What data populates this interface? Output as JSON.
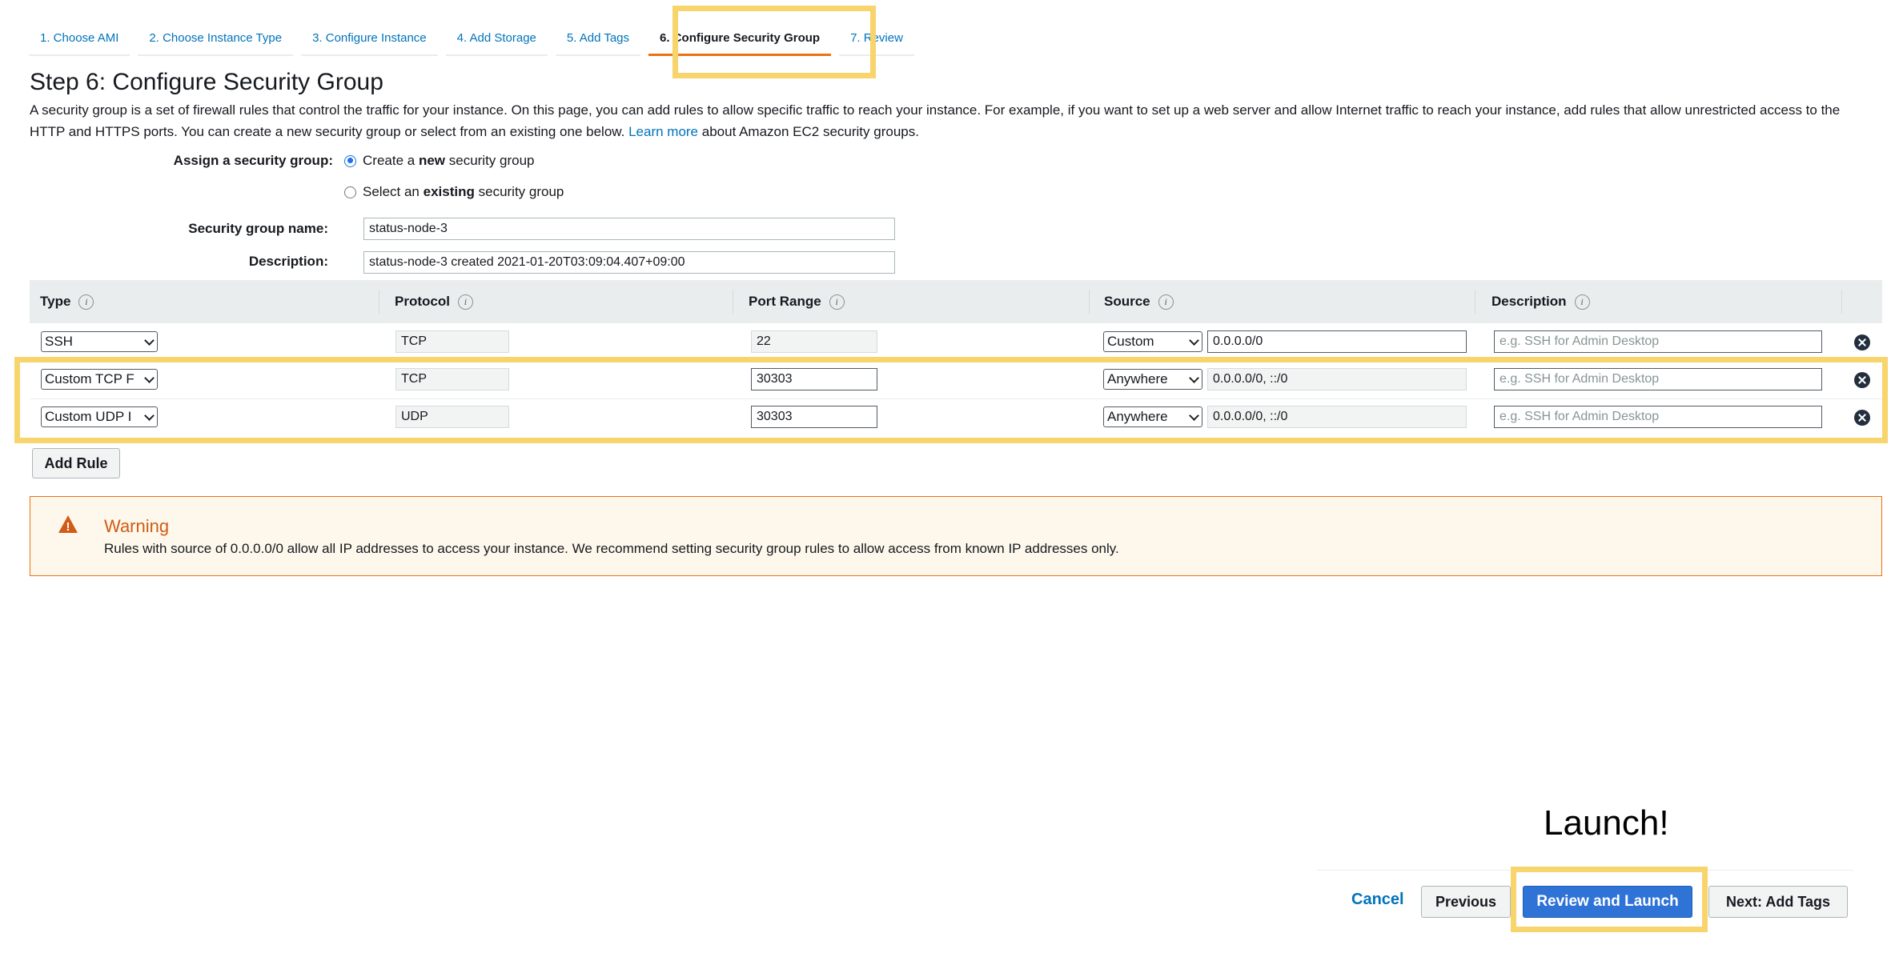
{
  "wizard": {
    "tabs": [
      {
        "label": "1. Choose AMI"
      },
      {
        "label": "2. Choose Instance Type"
      },
      {
        "label": "3. Configure Instance"
      },
      {
        "label": "4. Add Storage"
      },
      {
        "label": "5. Add Tags"
      },
      {
        "label": "6. Configure Security Group",
        "active": true
      },
      {
        "label": "7. Review"
      }
    ]
  },
  "page": {
    "title": "Step 6: Configure Security Group",
    "intro_before_link": "A security group is a set of firewall rules that control the traffic for your instance. On this page, you can add rules to allow specific traffic to reach your instance. For example, if you want to set up a web server and allow Internet traffic to reach your instance, add rules that allow unrestricted access to the HTTP and HTTPS ports. You can create a new security group or select from an existing one below.",
    "learn_more": "Learn more",
    "intro_after_link": "about Amazon EC2 security groups."
  },
  "form": {
    "assign_label": "Assign a security group:",
    "option_new_pre": "Create a",
    "option_new_bold": "new",
    "option_new_post": "security group",
    "option_existing_pre": "Select an",
    "option_existing_bold": "existing",
    "option_existing_post": "security group",
    "selected_option": "new",
    "name_label": "Security group name:",
    "name_value": "status-node-3",
    "description_label": "Description:",
    "description_value": "status-node-3 created 2021-01-20T03:09:04.407+09:00"
  },
  "table": {
    "headers": {
      "type": "Type",
      "protocol": "Protocol",
      "port_range": "Port Range",
      "source": "Source",
      "description": "Description"
    },
    "info_glyph": "i",
    "rows": [
      {
        "type": "SSH",
        "protocol": "TCP",
        "port": "22",
        "source_mode": "Custom",
        "source_cidr": "0.0.0.0/0",
        "description_placeholder": "e.g. SSH for Admin Desktop"
      },
      {
        "type": "Custom TCP F",
        "protocol": "TCP",
        "port": "30303",
        "source_mode": "Anywhere",
        "source_cidr": "0.0.0.0/0, ::/0",
        "description_placeholder": "e.g. SSH for Admin Desktop"
      },
      {
        "type": "Custom UDP I",
        "protocol": "UDP",
        "port": "30303",
        "source_mode": "Anywhere",
        "source_cidr": "0.0.0.0/0, ::/0",
        "description_placeholder": "e.g. SSH for Admin Desktop"
      }
    ],
    "add_rule": "Add Rule"
  },
  "warning": {
    "title": "Warning",
    "text": "Rules with source of 0.0.0.0/0 allow all IP addresses to access your instance. We recommend setting security group rules to allow access from known IP addresses only.",
    "icon_glyph": "!"
  },
  "footer": {
    "cancel": "Cancel",
    "previous": "Previous",
    "review_launch": "Review and Launch",
    "next": "Next: Add Tags"
  },
  "annotation": {
    "callout": "Launch!",
    "highlight_color": "#f8d46c"
  },
  "colors": {
    "link": "#0073bb",
    "primary_button": "#2f73d6",
    "warning_border": "#ec7211",
    "warning_title": "#d05c17",
    "warning_bg": "#fef8ec"
  },
  "icons": [
    "info-icon",
    "remove-rule-icon",
    "warning-icon",
    "chevron-down-icon"
  ]
}
